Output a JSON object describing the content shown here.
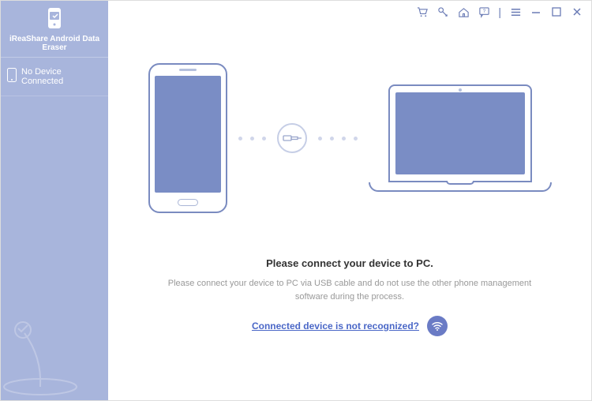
{
  "app": {
    "name": "iReaShare Android Data Eraser"
  },
  "sidebar": {
    "device_status": "No Device Connected"
  },
  "titlebar": {
    "cart": "cart",
    "key": "key",
    "home": "home",
    "feedback": "feedback",
    "menu": "menu",
    "minimize": "−",
    "maximize": "□",
    "close": "×"
  },
  "main": {
    "title": "Please connect your device to PC.",
    "subtitle": "Please connect your device to PC via USB cable and do not use the other phone management software during the process.",
    "not_recognized_link": "Connected device is not recognized?"
  }
}
